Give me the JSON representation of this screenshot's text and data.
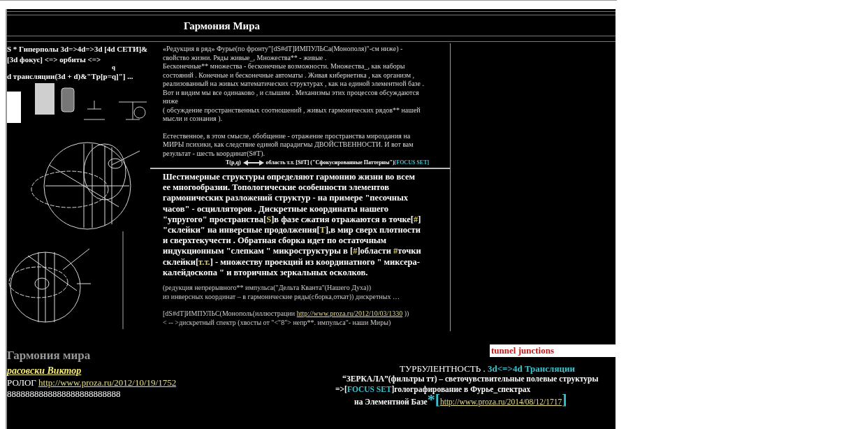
{
  "header": {
    "title": "Гармония Мира"
  },
  "left_column": {
    "lines": [
      "S * Гиперполы 3d=>4d=>3d    [4d СЕТИ]&",
      "[3d фокус] <=> орбиты <=>",
      "q",
      "d трансляции(3d + d)&\"Tр[p=q]\"] ..."
    ]
  },
  "intro_paragraphs": [
    [
      {
        "kind": "plain",
        "text": "«Редукция в ряд» Фурье(по фронту\"[dS#dT]ИМПУЛЬСа(Монополя)\"-см ниже) - свойство жизни. Ряды живые_, Множества** - живые ."
      }
    ],
    [
      {
        "kind": "plain",
        "text": "Бесконечные** множества - бесконечные возможности. Множества_, как наборы состояний . Конечные и бесконечные автоматы . Живая кибернетика , как организм , реализованный  на живых математических структурах , как на единой элементной базе . Вот и видим мы все одинаково , и слышим . Механизмы этих процессов обсуждаются ниже"
      }
    ],
    [
      {
        "kind": "plain",
        "text": "( обсуждение  пространственных соотношений , живых гармонических рядов** нашей мысли и сознания )."
      }
    ],
    [
      {
        "kind": "plain",
        "text": "Естественное, в этом смысле, обобщение - отражение пространства мироздания на МИРЫ психики, как следствие единой парадигмы  ДВОЙСТВЕННОСТИ. И вот вам результат - шесть координат(S#T)."
      }
    ]
  ],
  "focus_line": {
    "left": "T(p,q)",
    "right": [
      {
        "kind": "plain",
        "text": "область т.т. [S#T]  (\"Сфокусированные Паттерны\")"
      },
      {
        "kind": "cyan",
        "text": "[FOCUS SET]"
      }
    ]
  },
  "main_paragraph": [
    {
      "kind": "plain",
      "text": "Шестимерные структуры  определяют гармонию жизни во всем ее многообразии. Топологические  особенности элементов гармонических разложений структур - на примере \"песочных часов\"  - осцилляторов . Дискретные  координаты нашего \"упругого\" пространства["
    },
    {
      "kind": "accent",
      "text": "S"
    },
    {
      "kind": "plain",
      "text": "]в фазе сжатия  отражаются в точке["
    },
    {
      "kind": "accent",
      "text": "#"
    },
    {
      "kind": "plain",
      "text": "] \"склейки\" на инверсные продолжения["
    },
    {
      "kind": "accent",
      "text": "T"
    },
    {
      "kind": "plain",
      "text": "],в мир сверх плотности и сверхтекучести . Обратная сборка идет по остаточным индукционным \"слепкам \" микроструктуры  в ["
    },
    {
      "kind": "accent",
      "text": "#"
    },
    {
      "kind": "plain",
      "text": "]области "
    },
    {
      "kind": "accent",
      "text": "#"
    },
    {
      "kind": "plain",
      "text": "точки склейки["
    },
    {
      "kind": "accent",
      "text": "т.т."
    },
    {
      "kind": "plain",
      "text": "]  - множеству проекций из координатного \" миксера-калейдоскопа \" и вторичных зеркальных осколков."
    }
  ],
  "notes": [
    [
      {
        "kind": "plain",
        "text": "(редукция непрерывного** импульса(\"Дельта Кванта\"(Нашего Духа))"
      }
    ],
    [
      {
        "kind": "plain",
        "text": " из инверсных координат – в  гармонические  ряды(сборка,откат))  дискретных …"
      }
    ],
    [
      {
        "kind": "plain",
        "text": "[dS#dT]ИМПУЛЬС(Монополь(иллюстрации "
      },
      {
        "kind": "link",
        "text": "http://www.proza.ru/2012/10/03/1330"
      },
      {
        "kind": "plain",
        "text": " ))"
      }
    ],
    [
      {
        "kind": "plain",
        "text": "< -- >дискретный спектр (хвосты  от \"<\"8\"> непр**. импульса\"- наши Миры)"
      }
    ]
  ],
  "bottom": {
    "heading": "Гармония мира",
    "tag": "tunnel junctions",
    "author": "расовски Виктор",
    "prologue": [
      {
        "kind": "plain",
        "text": "РОЛОГ "
      },
      {
        "kind": "link",
        "text": "http://www.proza.ru/2012/10/19/1752"
      }
    ],
    "eights": "8888888888888888888888888",
    "right_lines": [
      [
        {
          "kind": "plain",
          "text": "ТУРБУЛЕНТНОСТЬ . "
        },
        {
          "kind": "cyan",
          "text": "3d<=>4d Трансляции"
        }
      ],
      [
        {
          "kind": "plain",
          "text": "“ЗЕРКАЛА”(фильтры тт) – светочувствительные полевые структуры"
        }
      ],
      [
        {
          "kind": "plain",
          "text": "=>["
        },
        {
          "kind": "cyan",
          "text": "FOCUS SET"
        },
        {
          "kind": "plain",
          "text": "]голографирование в Фурье_спектрах"
        }
      ],
      [
        {
          "kind": "plain",
          "text": "на Элементной Базе"
        },
        {
          "kind": "big-cyan",
          "text": "*"
        },
        {
          "kind": "big-cyan",
          "text": "["
        },
        {
          "kind": "link",
          "text": "http://www.proza.ru/2014/08/12/1717"
        },
        {
          "kind": "big-cyan",
          "text": "]"
        }
      ]
    ]
  }
}
